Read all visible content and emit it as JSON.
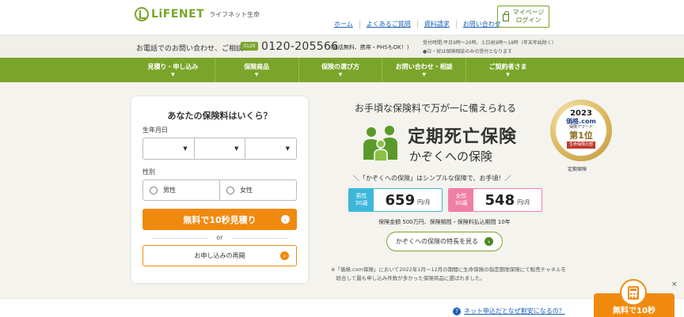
{
  "header": {
    "logo_text": "LiFENET",
    "logo_sub": "ライフネット生命",
    "nav": [
      "ホーム",
      "よくあるご質問",
      "資料請求",
      "お問い合わせ"
    ],
    "mypage": "マイページ\nログイン"
  },
  "phone": {
    "lead": "お電話でのお問い合わせ、ご相談",
    "free_badge": "0120",
    "number": "0120-205566",
    "note": "(通話無料、携帯・PHSもOK！)",
    "hours_1": "受付時間:平日9時～20時、土日祝9時～18時（年末年始除く）",
    "hours_2": "●日・祝は保険相談のみの受付となります"
  },
  "gnav": [
    "見積り・申し込み",
    "保険商品",
    "保険の選び方",
    "お問い合わせ・相談",
    "ご契約者さま"
  ],
  "form": {
    "title": "あなたの保険料はいくら？",
    "birth_label": "生年月日",
    "selects": [
      "▼",
      "▼",
      "▼"
    ],
    "sex_label": "性別",
    "male": "男性",
    "female": "女性",
    "quote_btn": "無料で10秒見積り",
    "or": "or",
    "resume_btn": "お申し込みの再開"
  },
  "promo": {
    "headline": "お手頃な保険料で万が一に備えられる",
    "title": "定期死亡保険",
    "subtitle": "かぞくへの保険",
    "tagline": "＼「かぞくへの保険」はシンプルな保障で、お手頃！／",
    "male_tag": "男性\n30歳",
    "male_price": "659",
    "female_tag": "女性\n30歳",
    "female_price": "548",
    "unit": "円/月",
    "coverage": "保険金額 500万円、保険期間・保険料払込期間 10年",
    "feature_btn": "かぞくへの保険の特長を見る",
    "footnote": "※「価格.com保険」において2022年1月～12月の期間に生命保険の指定期限保険にて販売チャネルを\n　総合して最も申し込み件数が多かった保険商品に選ばれました。"
  },
  "award": {
    "year": "2023",
    "brand": "価格.com",
    "award": "保険アワード",
    "rank": "第1位",
    "category": "生命保険の部",
    "caption": "定期保険"
  },
  "bottom": {
    "help": "ネット申込だとなぜ割安になるの？",
    "float_cta": "無料で10秒",
    "close": "×"
  },
  "colors": {
    "brand_green": "#7aa52a",
    "cta_orange": "#f08a0f",
    "male_blue": "#3db7d9",
    "female_pink": "#f07fa5"
  }
}
